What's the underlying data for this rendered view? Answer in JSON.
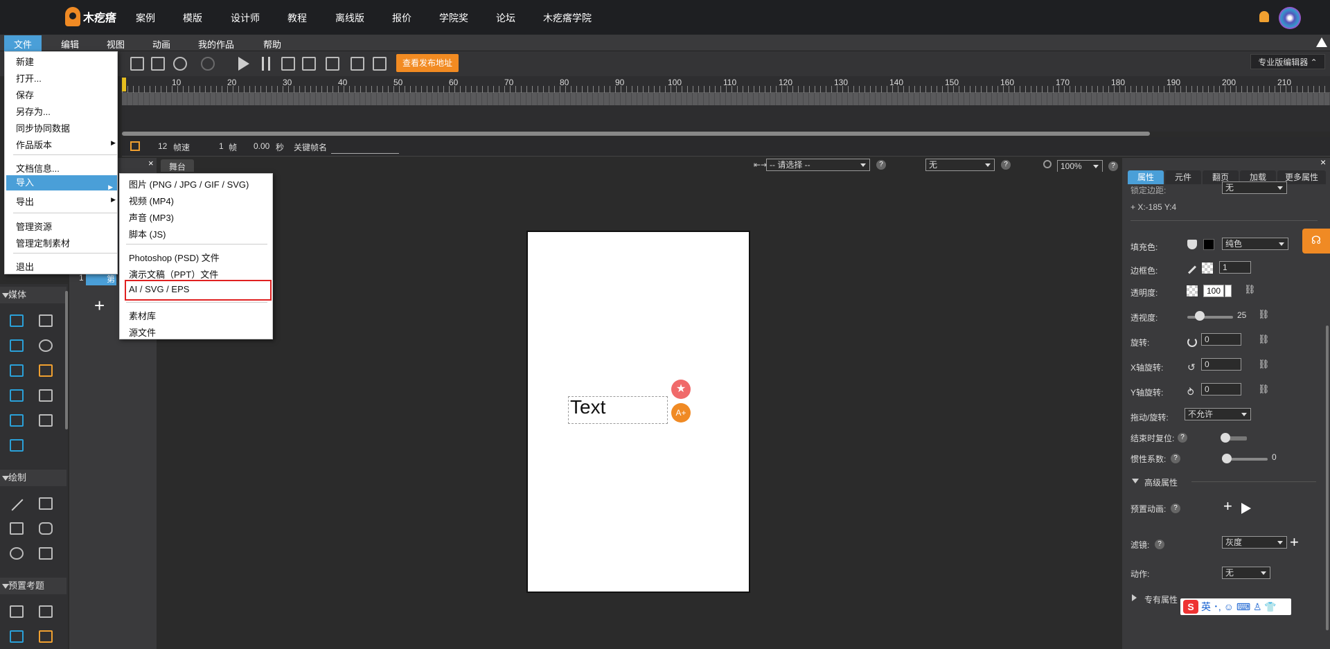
{
  "nav": {
    "logo": "木疙瘩",
    "items": [
      "案例",
      "模版",
      "设计师",
      "教程",
      "离线版",
      "报价",
      "学院奖",
      "论坛",
      "木疙瘩学院"
    ]
  },
  "menubar": [
    "文件",
    "编辑",
    "视图",
    "动画",
    "我的作品",
    "帮助"
  ],
  "toolbar": {
    "publish_label": "查看发布地址",
    "pro_editor_label": "专业版编辑器 ⌃"
  },
  "ruler": {
    "labels": [
      "10",
      "20",
      "30",
      "40",
      "50",
      "60",
      "70",
      "80",
      "90",
      "100",
      "110",
      "120",
      "130",
      "140",
      "150",
      "160",
      "170",
      "180",
      "190",
      "200",
      "210"
    ]
  },
  "timeline_status": {
    "fps_value": "12",
    "fps_label": "帧速",
    "frame_value": "1",
    "frame_label": "帧",
    "time_value": "0.00",
    "time_label": "秒",
    "keyframe_label": "关键帧名"
  },
  "file_menu": {
    "items": [
      "新建",
      "打开...",
      "保存",
      "另存为...",
      "同步协同数据",
      "作品版本",
      "文档信息...",
      "导入",
      "导出",
      "管理资源",
      "管理定制素材",
      "退出"
    ]
  },
  "import_submenu": {
    "items": [
      "图片 (PNG / JPG / GIF / SVG)",
      "视频 (MP4)",
      "声音 (MP3)",
      "脚本 (JS)",
      "Photoshop (PSD) 文件",
      "演示文稿（PPT）文件",
      "AI / SVG / EPS",
      "素材库",
      "源文件"
    ]
  },
  "left_panel": {
    "sections": [
      "媒体",
      "绘制",
      "预置考题"
    ]
  },
  "layers": {
    "row_number": "1",
    "row_label": "第"
  },
  "stage": {
    "tab": "舞台",
    "align_select": "-- 请选择 --",
    "none_select": "无",
    "zoom": "100%",
    "text_element": "Text"
  },
  "right_panel": {
    "tabs": [
      "属性",
      "元件",
      "翻页",
      "加载",
      "更多属性"
    ],
    "lock_label": "锁定边距:",
    "lock_value": "无",
    "coords": "+  X:-185   Y:4",
    "fill_label": "填充色:",
    "fill_type": "纯色",
    "stroke_label": "边框色:",
    "stroke_width": "1",
    "opacity_label": "透明度:",
    "opacity_value": "100",
    "transparency_label": "透视度:",
    "transparency_value": "25",
    "rotate_label": "旋转:",
    "rotate_value": "0",
    "xrot_label": "X轴旋转:",
    "xrot_value": "0",
    "yrot_label": "Y轴旋转:",
    "yrot_value": "0",
    "drag_label": "拖动/旋转:",
    "drag_value": "不允许",
    "reset_label": "结束时复位:",
    "inertia_label": "惯性系数:",
    "inertia_value": "0",
    "advanced_label": "高级属性",
    "preset_anim_label": "预置动画:",
    "filter_label": "滤镜:",
    "filter_value": "灰度",
    "action_label": "动作:",
    "action_value": "无",
    "special_label": "专有属性"
  },
  "ime": {
    "label": "英 ･, ☺ ⌨ ♙ 👕"
  },
  "colors": {
    "accent": "#4a9fd8",
    "orange": "#f28b22",
    "highlight_box": "#e02020"
  }
}
